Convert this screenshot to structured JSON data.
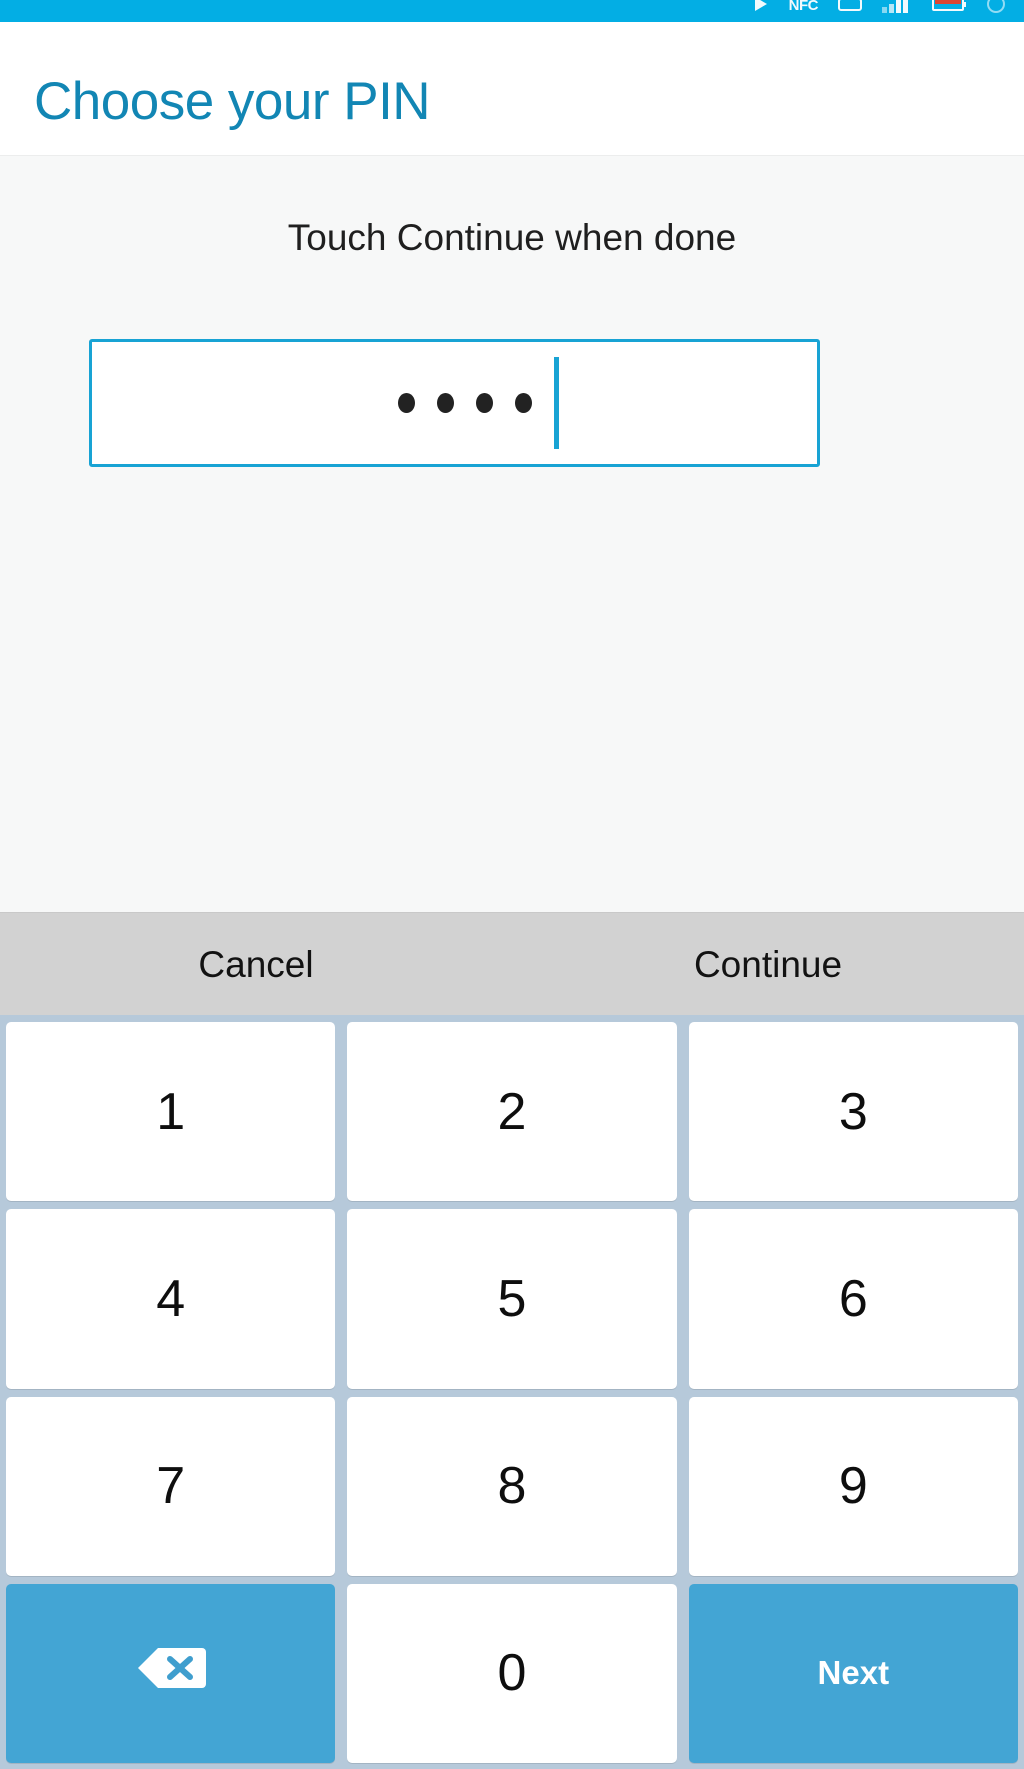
{
  "statusbar": {
    "icons": [
      {
        "name": "play-icon",
        "glyph": "▶"
      },
      {
        "name": "nfc-icon",
        "label": "NFC"
      },
      {
        "name": "sd-card-icon",
        "glyph": "▭"
      },
      {
        "name": "signal-bars-icon",
        "glyph": "▐"
      },
      {
        "name": "battery-icon",
        "glyph": "▭"
      },
      {
        "name": "clock-icon",
        "glyph": ""
      }
    ],
    "background_color": "#03aee4"
  },
  "header": {
    "title": "Choose your PIN",
    "title_color": "#1286b4",
    "background_color": "#ffffff"
  },
  "content": {
    "prompt": "Touch Continue when done",
    "background_color": "#f7f8f8",
    "pin_field": {
      "name": "pin-input",
      "masked_value": "••••",
      "digit_count": 4,
      "caret_visible": true,
      "border_color": "#18a3d4",
      "dot_color": "#222222"
    }
  },
  "actionbar": {
    "background_color": "#d2d2d2",
    "cancel_label": "Cancel",
    "continue_label": "Continue"
  },
  "keypad": {
    "background_color": "#b6c9da",
    "key_background": "#ffffff",
    "function_key_background": "#43a5d4",
    "rows": [
      [
        {
          "name": "key-1",
          "label": "1",
          "type": "digit"
        },
        {
          "name": "key-2",
          "label": "2",
          "type": "digit"
        },
        {
          "name": "key-3",
          "label": "3",
          "type": "digit"
        }
      ],
      [
        {
          "name": "key-4",
          "label": "4",
          "type": "digit"
        },
        {
          "name": "key-5",
          "label": "5",
          "type": "digit"
        },
        {
          "name": "key-6",
          "label": "6",
          "type": "digit"
        }
      ],
      [
        {
          "name": "key-7",
          "label": "7",
          "type": "digit"
        },
        {
          "name": "key-8",
          "label": "8",
          "type": "digit"
        },
        {
          "name": "key-9",
          "label": "9",
          "type": "digit"
        }
      ],
      [
        {
          "name": "key-backspace",
          "label": "",
          "type": "backspace"
        },
        {
          "name": "key-0",
          "label": "0",
          "type": "digit"
        },
        {
          "name": "key-next",
          "label": "Next",
          "type": "action"
        }
      ]
    ]
  }
}
